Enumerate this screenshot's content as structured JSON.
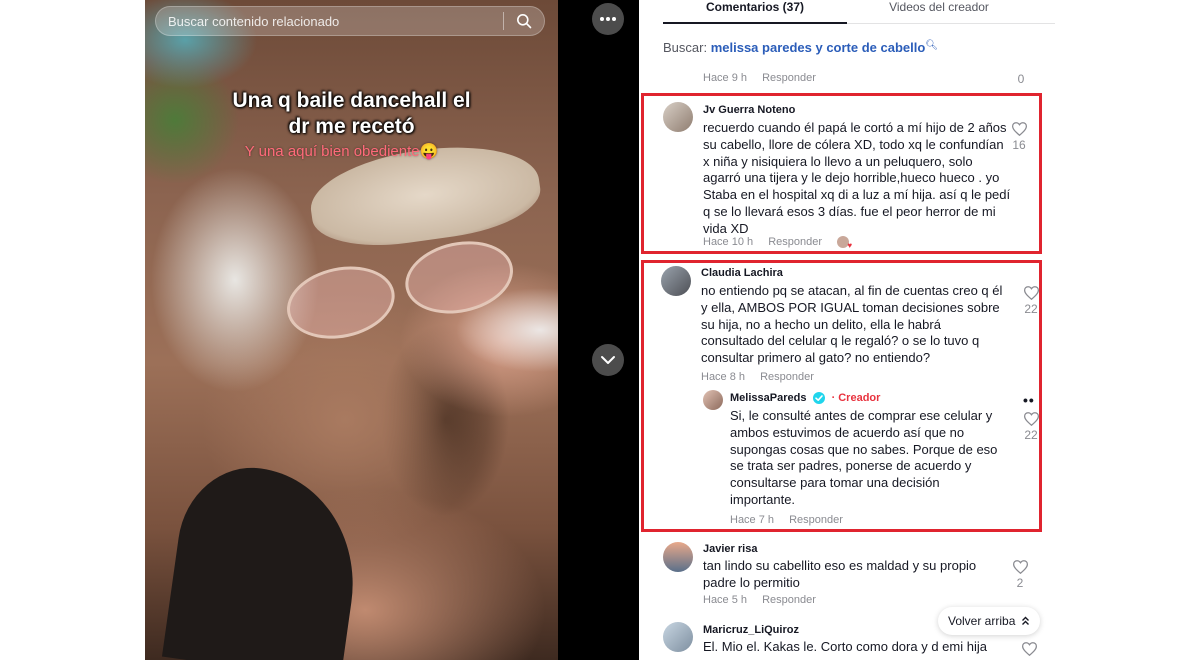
{
  "search": {
    "placeholder": "Buscar contenido relacionado"
  },
  "video": {
    "caption_line1": "Una q baile dancehall el",
    "caption_line2": "dr me recetó",
    "caption_sub": "Y una aquí bien obediente😛"
  },
  "tabs": {
    "comments": "Comentarios (37)",
    "creator_videos": "Videos del creador"
  },
  "related_search": {
    "label": "Buscar:",
    "query": "melissa paredes y corte de cabello"
  },
  "top_meta": {
    "time": "Hace 9 h",
    "reply": "Responder",
    "likes": "0"
  },
  "comments": [
    {
      "user": "Jv Guerra Noteno",
      "lines": [
        "recuerdo cuando él papá le cortó a mí hijo de 2 años",
        "su cabello, llore de cólera XD, todo xq le confundían",
        "x niña y nisiquiera lo llevo a un peluquero, solo",
        "agarró una tijera y le dejo horrible,hueco hueco . yo",
        "Staba en el hospital xq di a luz a mí hija. así q le pedí",
        "q se lo llevará esos 3 días. fue el peor herror de mi",
        "vida XD"
      ],
      "time": "Hace 10 h",
      "reply": "Responder",
      "likes": "16"
    },
    {
      "user": "Claudia Lachira",
      "lines": [
        "no entiendo pq se atacan, al fin de cuentas creo q él",
        "y ella, AMBOS POR IGUAL toman decisiones sobre",
        "su hija, no a hecho un delito, ella le habrá",
        "consultado del celular q le regaló? o se lo tuvo q",
        "consultar primero al gato? no entiendo?"
      ],
      "time": "Hace 8 h",
      "reply": "Responder",
      "likes": "22"
    },
    {
      "user": "MelissaPareds",
      "creator_tag": "Creador",
      "lines": [
        "Si, le consulté antes de comprar ese celular y",
        "ambos estuvimos de acuerdo así que no",
        "supongas cosas que no sabes. Porque de eso",
        "se trata ser padres, ponerse de acuerdo y",
        "consultarse para tomar una decisión",
        "importante."
      ],
      "time": "Hace 7 h",
      "reply": "Responder",
      "likes": "22"
    },
    {
      "user": "Javier risa",
      "lines": [
        "tan lindo su cabellito eso es maldad y su propio",
        "padre lo permitio"
      ],
      "time": "Hace 5 h",
      "reply": "Responder",
      "likes": "2"
    },
    {
      "user": "Maricruz_LiQuiroz",
      "lines": [
        "El. Mio el. Kakas le. Corto como dora y d emi hija"
      ]
    }
  ],
  "back_to_top": "Volver arriba",
  "colors": {
    "highlight": "#e0242f",
    "link": "#2b5db9",
    "creator": "#e8323e",
    "verified": "#20d5ec"
  },
  "icons": [
    "search-icon",
    "more-icon",
    "chevron-down-icon",
    "heart-icon",
    "verified-icon",
    "arrow-up-icon"
  ]
}
